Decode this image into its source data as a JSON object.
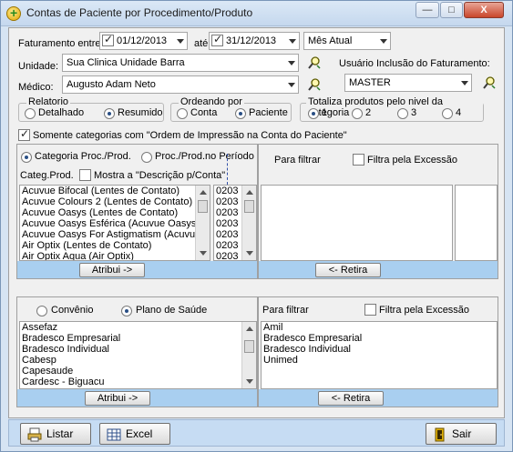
{
  "window": {
    "title": "Contas de Paciente por Procedimento/Produto",
    "btn_min": "—",
    "btn_max": "□",
    "btn_close": "X"
  },
  "filters": {
    "faturamento_label": "Faturamento entre:",
    "date_from": "01/12/2013",
    "ate_label": "até",
    "date_to": "31/12/2013",
    "period_value": "Mês Atual",
    "unidade_label": "Unidade:",
    "unidade_value": "Sua Clinica Unidade Barra",
    "medico_label": "Médico:",
    "medico_value": "Augusto Adam Neto",
    "usuario_label": "Usuário Inclusão do Faturamento:",
    "usuario_value": "MASTER"
  },
  "relatorio": {
    "title": "Relatorio",
    "opt1": "Detalhado",
    "opt2": "Resumido",
    "selected": "Resumido"
  },
  "ordenando": {
    "title": "Ordeando por",
    "opt1": "Conta",
    "opt2": "Paciente",
    "selected": "Paciente"
  },
  "totaliza": {
    "title": "Totaliza produtos pelo nivel da categoria",
    "opts": [
      "1",
      "2",
      "3",
      "4"
    ],
    "selected": "1"
  },
  "somente_label": "Somente categorias com \"Ordem de Impressão na Conta do Paciente\"",
  "top_left": {
    "radio1": "Categoria Proc./Prod.",
    "radio2": "Proc./Prod.no Período",
    "categ_label": "Categ.Prod.",
    "mostra_label": "Mostra a \"Descrição p/Conta\"",
    "items": [
      "Acuvue Bifocal (Lentes de Contato)",
      "Acuvue Colours 2 (Lentes de Contato)",
      "Acuvue Oasys (Lentes de Contato)",
      "Acuvue Oasys Esférica (Acuvue Oasys)",
      "Acuvue Oasys For Astigmatism (Acuvue",
      "Air Optix (Lentes de Contato)",
      "Air Optix Aqua (Air Optix)"
    ],
    "codes": [
      "0203",
      "0203",
      "0203",
      "0203",
      "0203",
      "0203",
      "0203"
    ],
    "atribui": "Atribui ->"
  },
  "top_right": {
    "para_filtrar": "Para filtrar",
    "filtra_label": "Filtra pela Excessão",
    "retira": "<- Retira"
  },
  "bottom_left": {
    "radio1": "Convênio",
    "radio2": "Plano de Saúde",
    "selected": "Plano de Saúde",
    "items": [
      "Assefaz",
      "Bradesco Empresarial",
      "Bradesco Individual",
      "Cabesp",
      "Capesaude",
      "Cardesc - Biguacu"
    ],
    "atribui": "Atribui ->"
  },
  "bottom_right": {
    "para_filtrar": "Para filtrar",
    "filtra_label": "Filtra pela Excessão",
    "items": [
      "Amil",
      "Bradesco Empresarial",
      "Bradesco Individual",
      "Unimed"
    ],
    "retira": "<- Retira"
  },
  "footer": {
    "listar": "Listar",
    "excel": "Excel",
    "sair": "Sair"
  }
}
